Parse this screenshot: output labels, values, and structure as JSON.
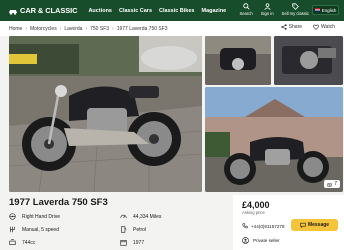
{
  "header": {
    "logo_text": "CAR & CLASSIC",
    "nav": [
      "Auctions",
      "Classic Cars",
      "Classic Bikes",
      "Magazine"
    ],
    "icons": [
      {
        "label": "Search",
        "icon": "search-icon"
      },
      {
        "label": "Sign in",
        "icon": "user-icon"
      },
      {
        "label": "Sell my classic",
        "icon": "tag-icon"
      }
    ],
    "language": "English",
    "colors": {
      "bar": "#184d2c",
      "accent": "#f5c43a"
    }
  },
  "breadcrumb": [
    "Home",
    "Motorcycles",
    "Laverda",
    "750 SF3",
    "1977 Laverda 750 SF3"
  ],
  "actions": {
    "share": "Share",
    "watch": "Watch"
  },
  "gallery": {
    "photo_count": "7"
  },
  "listing": {
    "title": "1977 Laverda 750 SF3",
    "specs": [
      {
        "icon": "steering-wheel-icon",
        "text": "Right Hand Drive"
      },
      {
        "icon": "odometer-icon",
        "text": "44,334 Miles"
      },
      {
        "icon": "gearbox-icon",
        "text": "Manual, 5 speed"
      },
      {
        "icon": "fuel-icon",
        "text": "Petrol"
      },
      {
        "icon": "engine-icon",
        "text": "744cc"
      },
      {
        "icon": "calendar-icon",
        "text": "1977"
      }
    ]
  },
  "seller_panel": {
    "price": "£4,000",
    "asking_label": "Asking price",
    "phone": "+44(0)91157278",
    "message_label": "Message",
    "seller_type": "Private seller"
  }
}
